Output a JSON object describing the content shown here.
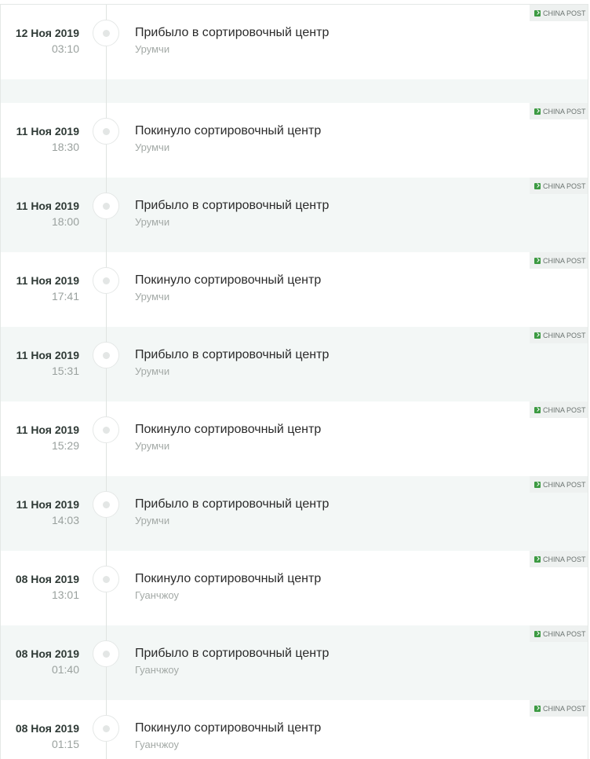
{
  "events": [
    {
      "date": "12 Ноя 2019",
      "time": "03:10",
      "status": "Прибыло в сортировочный центр",
      "city": "Урумчи",
      "carrier": "CHINA POST"
    },
    {
      "date": "11 Ноя 2019",
      "time": "18:30",
      "status": "Покинуло сортировочный центр",
      "city": "Урумчи",
      "carrier": "CHINA POST"
    },
    {
      "date": "11 Ноя 2019",
      "time": "18:00",
      "status": "Прибыло в сортировочный центр",
      "city": "Урумчи",
      "carrier": "CHINA POST"
    },
    {
      "date": "11 Ноя 2019",
      "time": "17:41",
      "status": "Покинуло сортировочный центр",
      "city": "Урумчи",
      "carrier": "CHINA POST"
    },
    {
      "date": "11 Ноя 2019",
      "time": "15:31",
      "status": "Прибыло в сортировочный центр",
      "city": "Урумчи",
      "carrier": "CHINA POST"
    },
    {
      "date": "11 Ноя 2019",
      "time": "15:29",
      "status": "Покинуло сортировочный центр",
      "city": "Урумчи",
      "carrier": "CHINA POST"
    },
    {
      "date": "11 Ноя 2019",
      "time": "14:03",
      "status": "Прибыло в сортировочный центр",
      "city": "Урумчи",
      "carrier": "CHINA POST"
    },
    {
      "date": "08 Ноя 2019",
      "time": "13:01",
      "status": "Покинуло сортировочный центр",
      "city": "Гуанчжоу",
      "carrier": "CHINA POST"
    },
    {
      "date": "08 Ноя 2019",
      "time": "01:40",
      "status": "Прибыло в сортировочный центр",
      "city": "Гуанчжоу",
      "carrier": "CHINA POST"
    },
    {
      "date": "08 Ноя 2019",
      "time": "01:15",
      "status": "Покинуло сортировочный центр",
      "city": "Гуанчжоу",
      "carrier": "CHINA POST"
    }
  ],
  "colors": {
    "accent": "#3c9a42",
    "alt_row": "#f3f7f6",
    "text": "#2b2b2b",
    "muted": "#a3a9a6"
  }
}
